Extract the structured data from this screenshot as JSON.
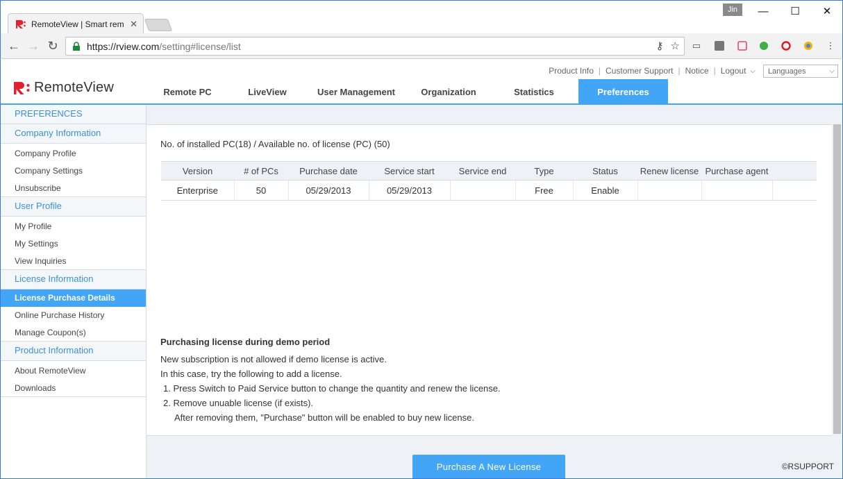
{
  "browser": {
    "tab_title": "RemoteView | Smart rem",
    "url_host": "https://rview.com",
    "url_path": "/setting#license/list",
    "user_badge": "Jin"
  },
  "header": {
    "logo_text": "RemoteView",
    "links": [
      "Product Info",
      "Customer Support",
      "Notice",
      "Logout"
    ],
    "language_label": "Languages"
  },
  "nav": {
    "items": [
      {
        "label": "Remote PC"
      },
      {
        "label": "LiveView"
      },
      {
        "label": "User Management"
      },
      {
        "label": "Organization"
      },
      {
        "label": "Statistics"
      },
      {
        "label": "Preferences",
        "active": true
      }
    ]
  },
  "sidebar": {
    "title": "PREFERENCES",
    "groups": [
      {
        "heading": "Company Information",
        "items": [
          "Company Profile",
          "Company Settings",
          "Unsubscribe"
        ]
      },
      {
        "heading": "User Profile",
        "items": [
          "My Profile",
          "My Settings",
          "View Inquiries"
        ]
      },
      {
        "heading": "License Information",
        "items": [
          "License Purchase Details",
          "Online Purchase History",
          "Manage Coupon(s)"
        ],
        "active_item": "License Purchase Details"
      },
      {
        "heading": "Product Information",
        "items": [
          "About RemoteView",
          "Downloads"
        ]
      }
    ]
  },
  "content": {
    "installed_summary": "No. of installed PC(18) / Available no. of license (PC) (50)",
    "table": {
      "columns": [
        "Version",
        "# of PCs",
        "Purchase date",
        "Service start",
        "Service end",
        "Type",
        "Status",
        "Renew license",
        "Purchase agent",
        ""
      ],
      "rows": [
        [
          "Enterprise",
          "50",
          "05/29/2013",
          "05/29/2013",
          "",
          "Free",
          "Enable",
          "",
          "",
          ""
        ]
      ]
    },
    "notice": {
      "title": "Purchasing license during demo period",
      "line1": "New subscription is not allowed if demo license is active.",
      "line2": "In this case, try the following to add a license.",
      "step1": "1. Press Switch to Paid Service button to change the quantity and renew the license.",
      "step2": "2. Remove unuable license (if exists).",
      "step2_sub": "After removing them, \"Purchase\" button will be enabled to buy new license."
    },
    "purchase_button": "Purchase A New License",
    "copyright": "©RSUPPORT"
  },
  "colors": {
    "accent": "#42a5f5",
    "brand_red": "#e5202e",
    "sidebar_heading": "#3a8fd9"
  }
}
